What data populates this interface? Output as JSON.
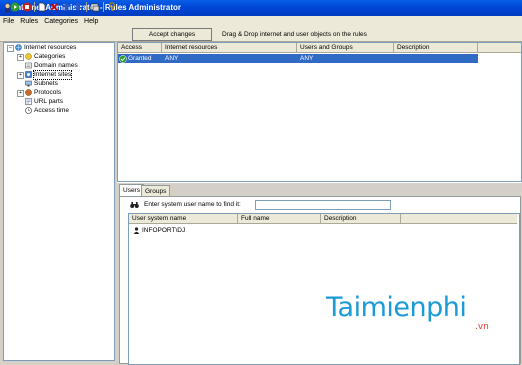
{
  "window": {
    "title": "Internet Administrator - Rules Administrator"
  },
  "menu": [
    "File",
    "Rules",
    "Categories",
    "Help"
  ],
  "toolbar": {
    "accept_label": "Accept changes",
    "hint": "Drag & Drop internet and user objects on the rules"
  },
  "tree": {
    "root": "Internet resources",
    "items": [
      "Categories",
      "Domain names",
      "Internet sites",
      "Subnets",
      "Protocols",
      "URL parts",
      "Access time"
    ]
  },
  "rules": {
    "columns": [
      "Access",
      "Internet resources",
      "Users and Groups",
      "Description"
    ],
    "rows": [
      {
        "access": "Granted",
        "resources": "ANY",
        "users": "ANY",
        "description": ""
      }
    ]
  },
  "lower": {
    "tabs": [
      "Users",
      "Groups"
    ],
    "find_label": "Enter system user name to find it:",
    "find_value": "",
    "columns": [
      "User system name",
      "Full name",
      "Description"
    ],
    "users": [
      "INFOPORT\\DJ"
    ]
  },
  "watermark": {
    "main": "Taimienphi",
    "sub": ".vn"
  },
  "colors": {
    "title_bar": "#0048d8",
    "selection": "#316ac5",
    "accent": "#1a9ad6"
  }
}
